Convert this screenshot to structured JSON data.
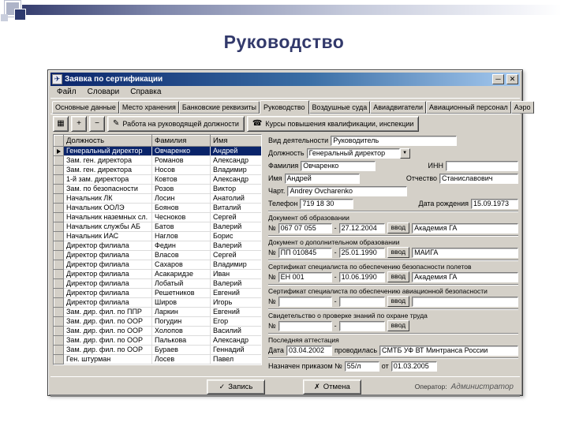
{
  "slide": {
    "title": "Руководство"
  },
  "icons": {
    "app": "✈",
    "minimize": "─",
    "close": "✕",
    "grid": "▦",
    "plus": "+",
    "minus": "−",
    "pencil": "✎",
    "courses": "☎",
    "save": "✓",
    "cancel": "✗",
    "dropdown": "▼"
  },
  "window": {
    "title": "Заявка по сертификации",
    "menu": {
      "items": [
        {
          "label": "Файл"
        },
        {
          "label": "Словари"
        },
        {
          "label": "Справка"
        }
      ]
    },
    "tabs": {
      "items": [
        {
          "label": "Основные данные",
          "active": false
        },
        {
          "label": "Место хранения",
          "active": false
        },
        {
          "label": "Банковские реквизиты",
          "active": false
        },
        {
          "label": "Руководство",
          "active": true
        },
        {
          "label": "Воздушные суда",
          "active": false
        },
        {
          "label": "Авиадвигатели",
          "active": false
        },
        {
          "label": "Авиационный персонал",
          "active": false
        },
        {
          "label": "Аэро",
          "active": false
        }
      ]
    },
    "toolbar": {
      "work_button": "Работа на руководящей должности",
      "courses_button": "Курсы повышения квалификации, инспекции"
    },
    "table": {
      "columns": [
        "Должность",
        "Фамилия",
        "Имя"
      ],
      "rows": [
        {
          "position": "Генеральный директор",
          "surname": "Овчаренко",
          "name": "Андрей",
          "selected": true
        },
        {
          "position": "Зам. ген. директора",
          "surname": "Романов",
          "name": "Александр"
        },
        {
          "position": "Зам. ген. директора",
          "surname": "Носов",
          "name": "Владимир"
        },
        {
          "position": "1-й зам. директора",
          "surname": "Ковтов",
          "name": "Александр"
        },
        {
          "position": "Зам. по безопасности",
          "surname": "Розов",
          "name": "Виктор"
        },
        {
          "position": "Начальник ЛК",
          "surname": "Лосин",
          "name": "Анатолий"
        },
        {
          "position": "Начальник ООЛЭ",
          "surname": "Боянов",
          "name": "Виталий"
        },
        {
          "position": "Начальник наземных сл.",
          "surname": "Чесноков",
          "name": "Сергей"
        },
        {
          "position": "Начальник службы АБ",
          "surname": "Батов",
          "name": "Валерий"
        },
        {
          "position": "Начальник ИАС",
          "surname": "Наглов",
          "name": "Борис"
        },
        {
          "position": "Директор филиала",
          "surname": "Федин",
          "name": "Валерий"
        },
        {
          "position": "Директор филиала",
          "surname": "Власов",
          "name": "Сергей"
        },
        {
          "position": "Директор филиала",
          "surname": "Сахаров",
          "name": "Владимир"
        },
        {
          "position": "Директор филиала",
          "surname": "Асакаридзе",
          "name": "Иван"
        },
        {
          "position": "Директор филиала",
          "surname": "Лобатый",
          "name": "Валерий"
        },
        {
          "position": "Директор филиала",
          "surname": "Решетников",
          "name": "Евгений"
        },
        {
          "position": "Директор филиала",
          "surname": "Широв",
          "name": "Игорь"
        },
        {
          "position": "Зам. дир. фил. по ППР",
          "surname": "Ларкин",
          "name": "Евгений"
        },
        {
          "position": "Зам. дир. фил. по ООР",
          "surname": "Погудин",
          "name": "Егор"
        },
        {
          "position": "Зам. дир. фил. по ООР",
          "surname": "Холопов",
          "name": "Василий"
        },
        {
          "position": "Зам. дир. фил. по ООР",
          "surname": "Палькова",
          "name": "Александр"
        },
        {
          "position": "Зам. дир. фил. по ООР",
          "surname": "Бураев",
          "name": "Геннадий"
        },
        {
          "position": "Ген. штурман",
          "surname": "Лосев",
          "name": "Павел"
        }
      ]
    },
    "form": {
      "activity_label": "Вид деятельности",
      "activity_value": "Руководитель",
      "position_label": "Должность",
      "position_value": "Генеральный директор",
      "surname_label": "Фамилия",
      "surname_value": "Овчаренко",
      "inn_label": "ИНН",
      "inn_value": "",
      "name_label": "Имя",
      "name_value": "Андрей",
      "patronymic_label": "Отчество",
      "patronymic_value": "Станиславович",
      "latin_label": "Чарт.",
      "latin_value": "Andrey Ovcharenko",
      "phone_label": "Телефон",
      "phone_value": "719 18 30",
      "birth_label": "Дата рождения",
      "birth_value": "15.09.1973",
      "no_label": "№",
      "dash": "-",
      "enter_label": "ввод",
      "docs": [
        {
          "title": "Документ об образовании",
          "number": "067 07 055",
          "date": "27.12.2004",
          "org": "Академия ГА"
        },
        {
          "title": "Документ о дополнительном образовании",
          "number": "ПП 010845",
          "date": "25.01.1990",
          "org": "МАИГА"
        },
        {
          "title": "Сертификат специалиста по обеспечению безопасности полетов",
          "number": "ЕН 001",
          "date": "10.06.1990",
          "org": "Академия ГА"
        },
        {
          "title": "Сертификат специалиста по обеспечению авиационной безопасности",
          "number": "",
          "date": "",
          "org": ""
        },
        {
          "title": "Свидетельство о проверке знаний по охране труда",
          "number": "",
          "date": "",
          "org": null
        }
      ],
      "attestation_label": "Последняя аттестация",
      "attestation_date_label": "Дата",
      "attestation_date": "03.04.2002",
      "attestation_by_label": "проводилась",
      "attestation_by": "СМТБ УФ ВТ Минтранса России",
      "order_label": "Назначен приказом №",
      "order_number": "55/л",
      "order_from_label": "от",
      "order_date": "01.03.2005"
    },
    "footer": {
      "save_label": "Запись",
      "cancel_label": "Отмена",
      "operator_label": "Оператор:",
      "operator_value": "Администратор"
    }
  }
}
